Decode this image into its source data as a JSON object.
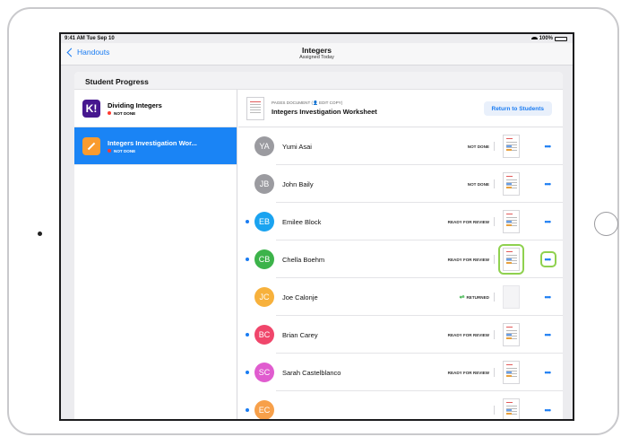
{
  "status_bar": {
    "time": "9:41 AM  Tue Sep 10",
    "battery": "100%"
  },
  "nav": {
    "back_label": "Handouts",
    "title": "Integers",
    "subtitle": "Assigned Today"
  },
  "card": {
    "header": "Student Progress"
  },
  "assignments": [
    {
      "icon": "kahoot-icon",
      "icon_letter": "K!",
      "title": "Dividing Integers",
      "status": "NOT DONE"
    },
    {
      "icon": "pages-icon",
      "title": "Integers Investigation Wor...",
      "status": "NOT DONE",
      "selected": true
    }
  ],
  "document": {
    "kind": "PAGES DOCUMENT (👤 EDIT COPY)",
    "title": "Integers Investigation Worksheet",
    "return_button": "Return to Students"
  },
  "students": [
    {
      "initials": "YA",
      "name": "Yumi Asai",
      "status": "NOT DONE",
      "color": "#9b9ba0",
      "dot": false,
      "thumb": "work"
    },
    {
      "initials": "JB",
      "name": "John Baily",
      "status": "NOT DONE",
      "color": "#9b9ba0",
      "dot": false,
      "thumb": "work"
    },
    {
      "initials": "EB",
      "name": "Emilee Block",
      "status": "READY FOR REVIEW",
      "color": "#1aa3f0",
      "dot": true,
      "thumb": "work"
    },
    {
      "initials": "CB",
      "name": "Chella Boehm",
      "status": "READY FOR REVIEW",
      "color": "#3cb34a",
      "dot": true,
      "thumb": "work",
      "highlighted": true
    },
    {
      "initials": "JC",
      "name": "Joe Calonje",
      "status": "RETURNED",
      "color": "#f7b13c",
      "dot": false,
      "thumb": "blank",
      "returned": true
    },
    {
      "initials": "BC",
      "name": "Brian Carey",
      "status": "READY FOR REVIEW",
      "color": "#f0466b",
      "dot": true,
      "thumb": "work"
    },
    {
      "initials": "SC",
      "name": "Sarah Castelblanco",
      "status": "READY FOR REVIEW",
      "color": "#e05ccf",
      "dot": true,
      "thumb": "work"
    },
    {
      "initials": "EC",
      "name": "",
      "status": "",
      "color": "#f7a04a",
      "dot": true,
      "thumb": "work"
    }
  ],
  "more_label": "•••",
  "colors": {
    "accent": "#1a7cf2",
    "highlight": "#8fd14f",
    "not_done": "#ff3b30"
  }
}
